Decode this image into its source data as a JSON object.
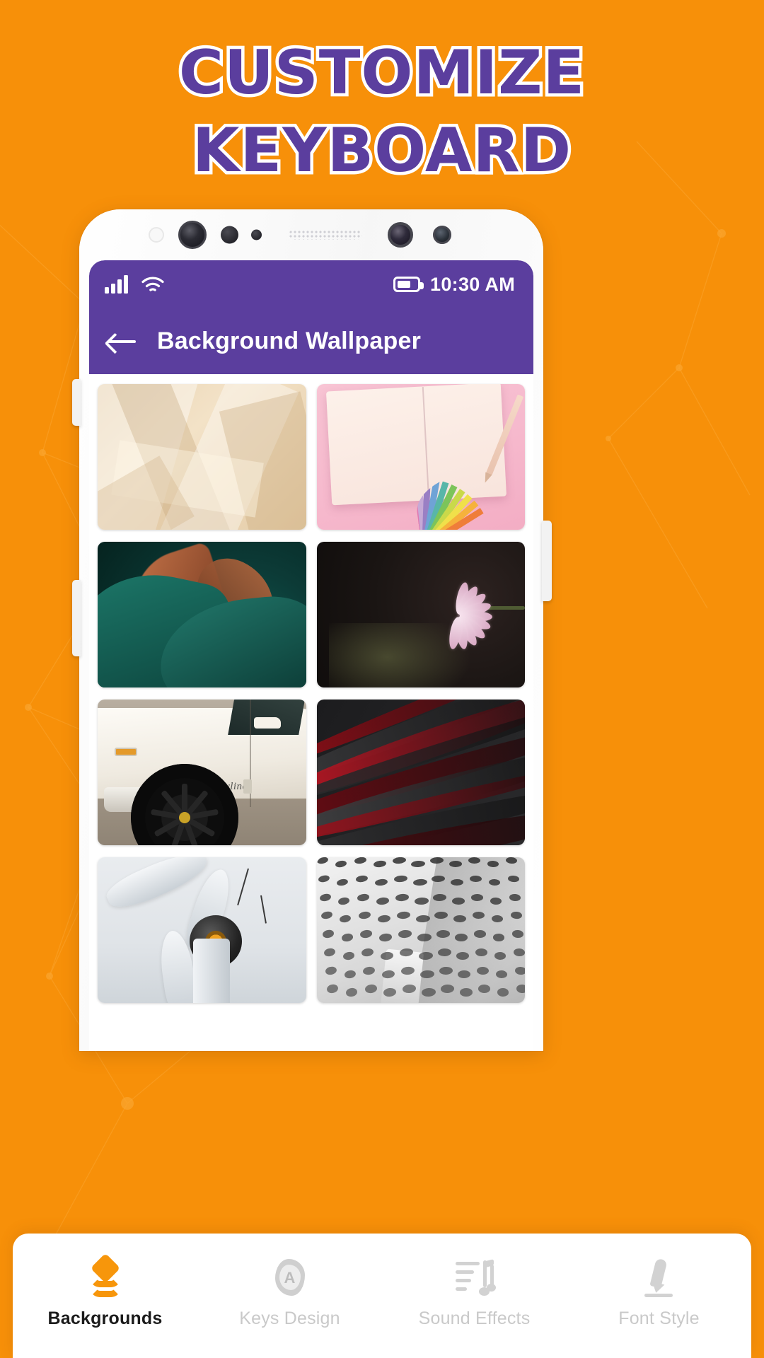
{
  "theme": {
    "background": "#F79009",
    "accent_purple": "#5B3E9E",
    "accent_orange": "#F7960B",
    "card_white": "#FFFFFF",
    "inactive_gray": "#C9C9C9"
  },
  "promo": {
    "headline_line1": "CUSTOMIZE",
    "headline_line2": "KEYBOARD"
  },
  "phone": {
    "status_bar": {
      "signal_icon": "signal-bars-icon",
      "wifi_icon": "wifi-icon",
      "battery_icon": "battery-icon",
      "time": "10:30 AM"
    },
    "app_bar": {
      "back_icon": "back-arrow-icon",
      "title": "Background Wallpaper"
    },
    "wallpaper_grid": [
      {
        "id": 1,
        "name": "beige-folded-paper",
        "label": "Beige folded paper abstract"
      },
      {
        "id": 2,
        "name": "pink-notebook",
        "label": "Notebook and pencil on pink"
      },
      {
        "id": 3,
        "name": "green-orange-silk",
        "label": "Green and orange silk folds"
      },
      {
        "id": 4,
        "name": "pink-lily-dark",
        "label": "Pink lily flower on dark"
      },
      {
        "id": 5,
        "name": "white-skyline-car",
        "label": "White Skyline classic car"
      },
      {
        "id": 6,
        "name": "red-dark-waves",
        "label": "Red and dark grey waves"
      },
      {
        "id": 7,
        "name": "wind-turbine",
        "label": "Wind turbine hub close-up"
      },
      {
        "id": 8,
        "name": "lattice-facade",
        "label": "White lattice building facade"
      }
    ],
    "car_badge_text": "Skyline"
  },
  "bottom_nav": {
    "items": [
      {
        "label": "Backgrounds",
        "icon": "layers-icon",
        "active": true
      },
      {
        "label": "Keys Design",
        "icon": "key-letter-a-icon",
        "active": false
      },
      {
        "label": "Sound Effects",
        "icon": "music-note-icon",
        "active": false
      },
      {
        "label": "Font Style",
        "icon": "pen-nib-icon",
        "active": false
      }
    ]
  }
}
